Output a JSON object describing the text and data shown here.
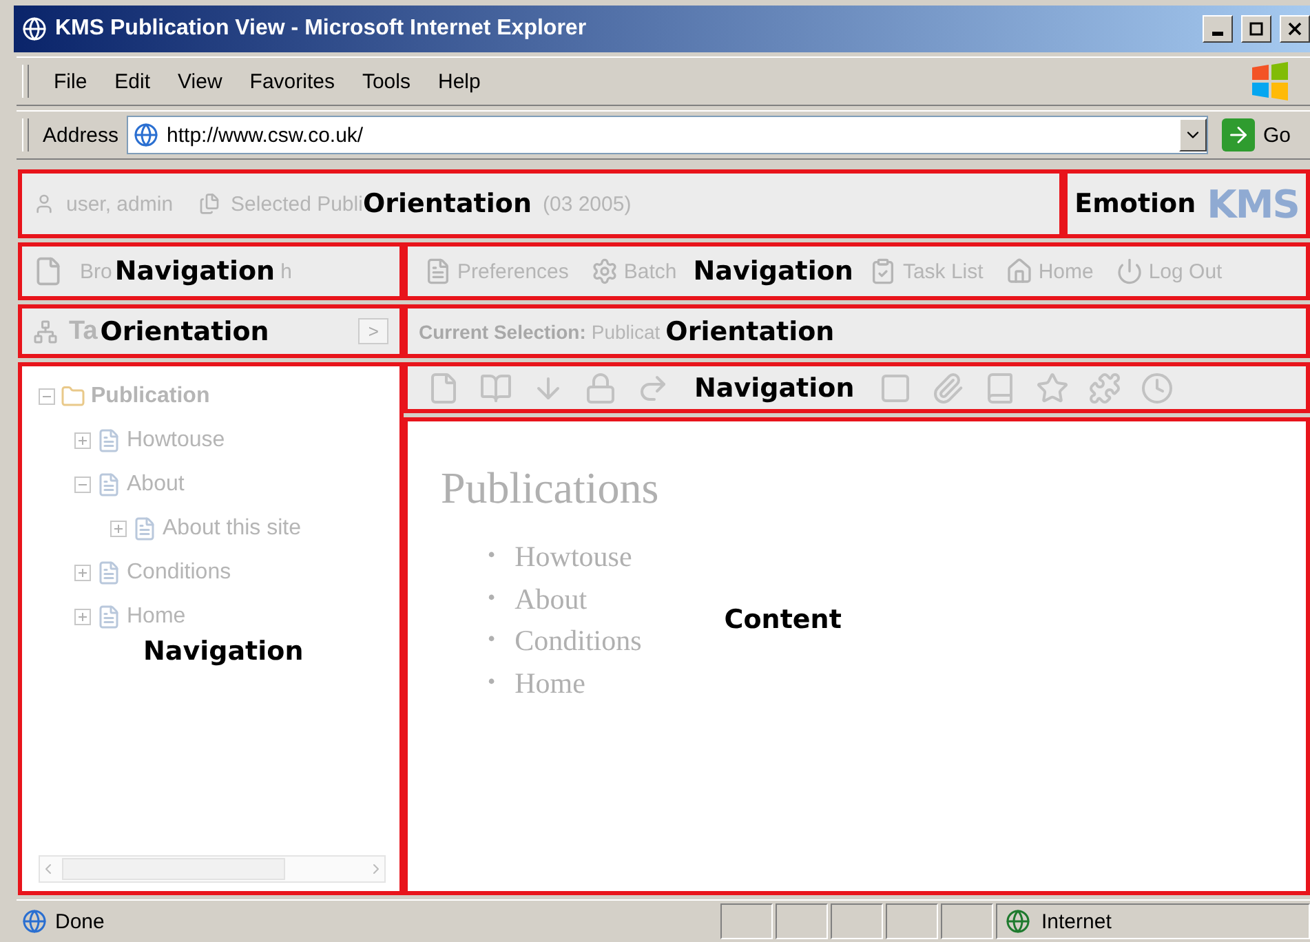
{
  "window": {
    "title": "KMS Publication View - Microsoft Internet Explorer"
  },
  "menu": [
    "File",
    "Edit",
    "View",
    "Favorites",
    "Tools",
    "Help"
  ],
  "address_bar": {
    "label": "Address",
    "url": "http://www.csw.co.uk/",
    "go": "Go"
  },
  "user_bar": {
    "annotation": "Orientation",
    "user": "user, admin",
    "publication_before": "Selected Publi",
    "publication_after": "(03 2005)"
  },
  "emotion": {
    "annotation": "Emotion",
    "logo": "KMS"
  },
  "left_toolbar": {
    "annotation": "Navigation",
    "before": "Bro",
    "after": "h"
  },
  "main_toolbar": {
    "annotation": "Navigation",
    "items_before": [
      {
        "label": "Preferences"
      },
      {
        "label": "Batch"
      }
    ],
    "items_after": [
      {
        "label": "Task List"
      },
      {
        "label": "Home"
      },
      {
        "label": "Log Out"
      }
    ]
  },
  "taxonomy_bar": {
    "annotation": "Orientation",
    "title": "Ta",
    "button": ">"
  },
  "selection_bar": {
    "annotation": "Orientation",
    "label": "Current Selection:",
    "value": "Publicat"
  },
  "page_toolbar": {
    "annotation": "Navigation"
  },
  "tree": {
    "annotation": "Navigation",
    "items": [
      {
        "label": "Publication",
        "expanded": true,
        "children": [
          {
            "label": "Howtouse",
            "expanded": false
          },
          {
            "label": "About",
            "expanded": true,
            "children": [
              {
                "label": "About this site",
                "expanded": false
              }
            ]
          },
          {
            "label": "Conditions",
            "expanded": false
          },
          {
            "label": "Home",
            "expanded": false
          }
        ]
      }
    ]
  },
  "content": {
    "annotation": "Content",
    "heading": "Publications",
    "bullet": "•",
    "list": [
      "Howtouse",
      "About",
      "Conditions",
      "Home"
    ]
  },
  "status_bar": {
    "text": "Done",
    "zone": "Internet"
  }
}
